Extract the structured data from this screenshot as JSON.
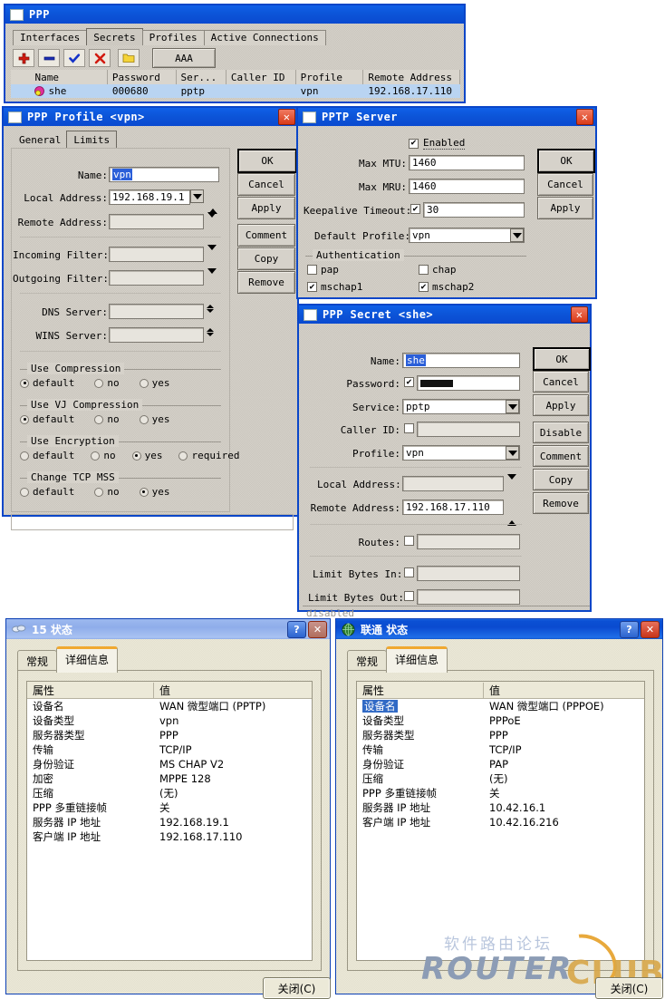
{
  "ppp_window": {
    "title": "PPP",
    "tabs": [
      {
        "label": "Interfaces",
        "selected": false
      },
      {
        "label": "Secrets",
        "selected": true
      },
      {
        "label": "Profiles",
        "selected": false
      },
      {
        "label": "Active Connections",
        "selected": false
      }
    ],
    "toolbar": {
      "add_icon": "plus-icon",
      "remove_icon": "minus-icon",
      "enable_icon": "check-icon",
      "disable_icon": "cross-icon",
      "comment_icon": "folder-icon",
      "aaa_label": "AAA"
    },
    "grid": {
      "columns": [
        "Name",
        "Password",
        "Ser...",
        "Caller ID",
        "Profile",
        "Remote Address"
      ],
      "rows": [
        {
          "name": "she",
          "password": "000680",
          "service": "pptp",
          "caller_id": "",
          "profile": "vpn",
          "remote_address": "192.168.17.110",
          "selected": true
        }
      ]
    }
  },
  "ppp_profile": {
    "title": "PPP Profile <vpn>",
    "tabs": [
      {
        "label": "General",
        "selected": true
      },
      {
        "label": "Limits",
        "selected": false
      }
    ],
    "fields": {
      "name_label": "Name:",
      "name_value": "vpn",
      "local_address_label": "Local Address:",
      "local_address_value": "192.168.19.1",
      "remote_address_label": "Remote Address:",
      "remote_address_value": "",
      "incoming_filter_label": "Incoming Filter:",
      "incoming_filter_value": "",
      "outgoing_filter_label": "Outgoing Filter:",
      "outgoing_filter_value": "",
      "dns_server_label": "DNS Server:",
      "dns_server_value": "",
      "wins_server_label": "WINS Server:",
      "wins_server_value": ""
    },
    "groups": [
      {
        "legend": "Use Compression",
        "options": [
          {
            "label": "default",
            "selected": true
          },
          {
            "label": "no",
            "selected": false
          },
          {
            "label": "yes",
            "selected": false
          }
        ]
      },
      {
        "legend": "Use VJ Compression",
        "options": [
          {
            "label": "default",
            "selected": true
          },
          {
            "label": "no",
            "selected": false
          },
          {
            "label": "yes",
            "selected": false
          }
        ]
      },
      {
        "legend": "Use Encryption",
        "options": [
          {
            "label": "default",
            "selected": false
          },
          {
            "label": "no",
            "selected": false
          },
          {
            "label": "yes",
            "selected": true
          },
          {
            "label": "required",
            "selected": false
          }
        ]
      },
      {
        "legend": "Change TCP MSS",
        "options": [
          {
            "label": "default",
            "selected": false
          },
          {
            "label": "no",
            "selected": false
          },
          {
            "label": "yes",
            "selected": true
          }
        ]
      }
    ],
    "buttons": [
      "OK",
      "Cancel",
      "Apply",
      "Comment",
      "Copy",
      "Remove"
    ]
  },
  "pptp_server": {
    "title": "PPTP Server",
    "enabled_label": "Enabled",
    "enabled_checked": true,
    "fields": {
      "max_mtu_label": "Max MTU:",
      "max_mtu_value": "1460",
      "max_mru_label": "Max MRU:",
      "max_mru_value": "1460",
      "keepalive_label": "Keepalive Timeout:",
      "keepalive_checked": true,
      "keepalive_value": "30",
      "default_profile_label": "Default Profile:",
      "default_profile_value": "vpn"
    },
    "auth_legend": "Authentication",
    "auth": [
      {
        "label": "pap",
        "checked": false
      },
      {
        "label": "chap",
        "checked": false
      },
      {
        "label": "mschap1",
        "checked": true
      },
      {
        "label": "mschap2",
        "checked": true
      }
    ],
    "buttons": [
      "OK",
      "Cancel",
      "Apply"
    ]
  },
  "ppp_secret": {
    "title": "PPP Secret <she>",
    "fields": {
      "name_label": "Name:",
      "name_value": "she",
      "password_label": "Password:",
      "password_checked": true,
      "password_value": "",
      "service_label": "Service:",
      "service_value": "pptp",
      "caller_id_label": "Caller ID:",
      "caller_id_checked": false,
      "caller_id_value": "",
      "profile_label": "Profile:",
      "profile_value": "vpn",
      "local_address_label": "Local Address:",
      "local_address_value": "",
      "remote_address_label": "Remote Address:",
      "remote_address_value": "192.168.17.110",
      "routes_label": "Routes:",
      "routes_checked": false,
      "routes_value": "",
      "limit_bytes_in_label": "Limit Bytes In:",
      "limit_bytes_in_checked": false,
      "limit_bytes_in_value": "",
      "limit_bytes_out_label": "Limit Bytes Out:",
      "limit_bytes_out_checked": false,
      "limit_bytes_out_value": ""
    },
    "status": "disabled",
    "buttons": [
      "OK",
      "Cancel",
      "Apply",
      "Disable",
      "Comment",
      "Copy",
      "Remove"
    ]
  },
  "status_left": {
    "title": "15 状态",
    "icon": "network-connection-icon",
    "help_label": "?",
    "close_label": "✕",
    "tabs": [
      {
        "label": "常规",
        "selected": false
      },
      {
        "label": "详细信息",
        "selected": true
      }
    ],
    "columns": [
      "属性",
      "值"
    ],
    "rows": [
      {
        "prop": "设备名",
        "value": "WAN 微型端口 (PPTP)",
        "selected": false
      },
      {
        "prop": "设备类型",
        "value": "vpn",
        "selected": false
      },
      {
        "prop": "服务器类型",
        "value": "PPP",
        "selected": false
      },
      {
        "prop": "传输",
        "value": "TCP/IP",
        "selected": false
      },
      {
        "prop": "身份验证",
        "value": "MS CHAP V2",
        "selected": false
      },
      {
        "prop": "加密",
        "value": "MPPE 128",
        "selected": false
      },
      {
        "prop": "压缩",
        "value": "(无)",
        "selected": false
      },
      {
        "prop": "PPP 多重链接帧",
        "value": "关",
        "selected": false
      },
      {
        "prop": "服务器 IP 地址",
        "value": "192.168.19.1",
        "selected": false
      },
      {
        "prop": "客户端 IP 地址",
        "value": "192.168.17.110",
        "selected": false
      }
    ],
    "close_button": "关闭(C)"
  },
  "status_right": {
    "title": "联通 状态",
    "icon": "globe-icon",
    "help_label": "?",
    "close_label": "✕",
    "tabs": [
      {
        "label": "常规",
        "selected": false
      },
      {
        "label": "详细信息",
        "selected": true
      }
    ],
    "columns": [
      "属性",
      "值"
    ],
    "rows": [
      {
        "prop": "设备名",
        "value": "WAN 微型端口 (PPPOE)",
        "selected": true
      },
      {
        "prop": "设备类型",
        "value": "PPPoE",
        "selected": false
      },
      {
        "prop": "服务器类型",
        "value": "PPP",
        "selected": false
      },
      {
        "prop": "传输",
        "value": "TCP/IP",
        "selected": false
      },
      {
        "prop": "身份验证",
        "value": "PAP",
        "selected": false
      },
      {
        "prop": "压缩",
        "value": "(无)",
        "selected": false
      },
      {
        "prop": "PPP 多重链接帧",
        "value": "关",
        "selected": false
      },
      {
        "prop": "服务器 IP 地址",
        "value": "10.42.16.1",
        "selected": false
      },
      {
        "prop": "客户端 IP 地址",
        "value": "10.42.16.216",
        "selected": false
      }
    ],
    "close_button": "关闭(C)"
  },
  "watermark": {
    "chinese": "软件路由论坛",
    "router": "ROUTER",
    "club": "CLUB"
  },
  "colors": {
    "titlebar_blue": "#0a4ad0",
    "selection_blue": "#316ac5",
    "dialog_face": "#d6d2ca",
    "xp_face": "#ece9d8",
    "tab_accent": "#f0a830",
    "close_red": "#c7341a"
  }
}
